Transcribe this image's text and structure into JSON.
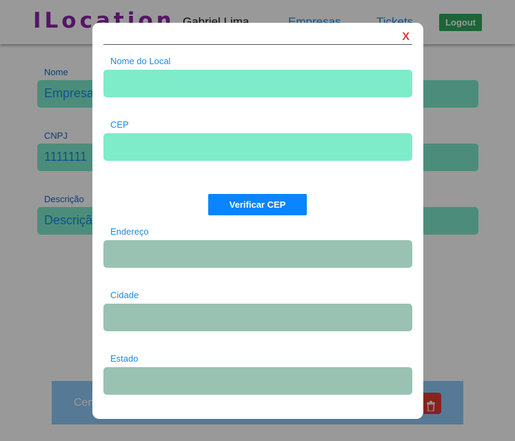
{
  "header": {
    "brand": "ILocation",
    "user_name": "Gabriel Lima",
    "nav": {
      "empresas": "Empresas",
      "tickets": "Tickets"
    },
    "logout_label": "Logout"
  },
  "background_form": {
    "fields": [
      {
        "label": "Nome",
        "value": "Empresa"
      },
      {
        "label": "CNPJ",
        "value": "1111111"
      },
      {
        "label": "Descrição",
        "value": "Descrição"
      }
    ],
    "card_text": "Cen"
  },
  "modal": {
    "close_label": "X",
    "fields": [
      {
        "label": "Nome do Local",
        "value": ""
      },
      {
        "label": "CEP",
        "value": ""
      },
      {
        "label": "Endereço",
        "value": ""
      },
      {
        "label": "Cidade",
        "value": ""
      },
      {
        "label": "Estado",
        "value": ""
      }
    ],
    "verify_label": "Verificar CEP"
  },
  "colors": {
    "brand": "#8e24aa",
    "link": "#1e88e5",
    "logout": "#2fa85a",
    "field_active": "#7eecc8",
    "field_locked": "#99c2b2",
    "verify_button": "#0a84ff",
    "close": "#e53935",
    "delete": "#e53935"
  },
  "icons": {
    "delete": "trash-icon"
  }
}
